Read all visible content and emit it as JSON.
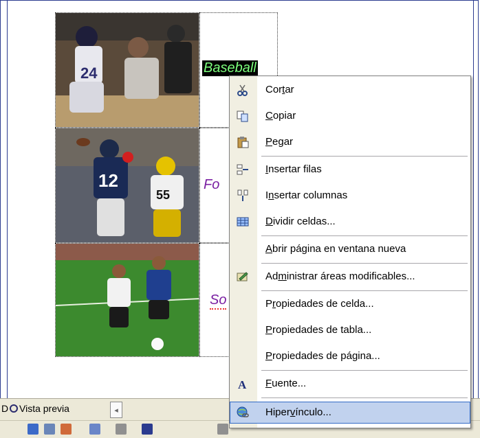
{
  "editor": {
    "labels": {
      "baseball": "Baseball",
      "football": "Fo",
      "soccer": "So"
    }
  },
  "tabs": {
    "preview_prefix": "D",
    "preview_label": "Vista previa"
  },
  "context_menu": {
    "items": [
      {
        "label": "Cortar",
        "icon": "scissors-icon"
      },
      {
        "label": "Copiar",
        "icon": "copy-icon"
      },
      {
        "label": "Pegar",
        "icon": "paste-icon"
      },
      {
        "label": "Insertar filas",
        "icon": "insert-rows-icon"
      },
      {
        "label": "Insertar columnas",
        "icon": "insert-columns-icon"
      },
      {
        "label": "Dividir celdas...",
        "icon": "split-cells-icon"
      },
      {
        "label": "Abrir página en ventana nueva",
        "icon": ""
      },
      {
        "label": "Administrar áreas modificables...",
        "icon": "editable-areas-icon"
      },
      {
        "label": "Propiedades de celda...",
        "icon": ""
      },
      {
        "label": "Propiedades de tabla...",
        "icon": ""
      },
      {
        "label": "Propiedades de página...",
        "icon": ""
      },
      {
        "label": "Fuente...",
        "icon": "font-icon"
      },
      {
        "label": "Hipervínculo...",
        "icon": "hyperlink-icon"
      }
    ]
  },
  "colors": {
    "highlight": "#c1d2ee",
    "highlight_border": "#316ac5",
    "frame_border": "#2b3b8f"
  }
}
